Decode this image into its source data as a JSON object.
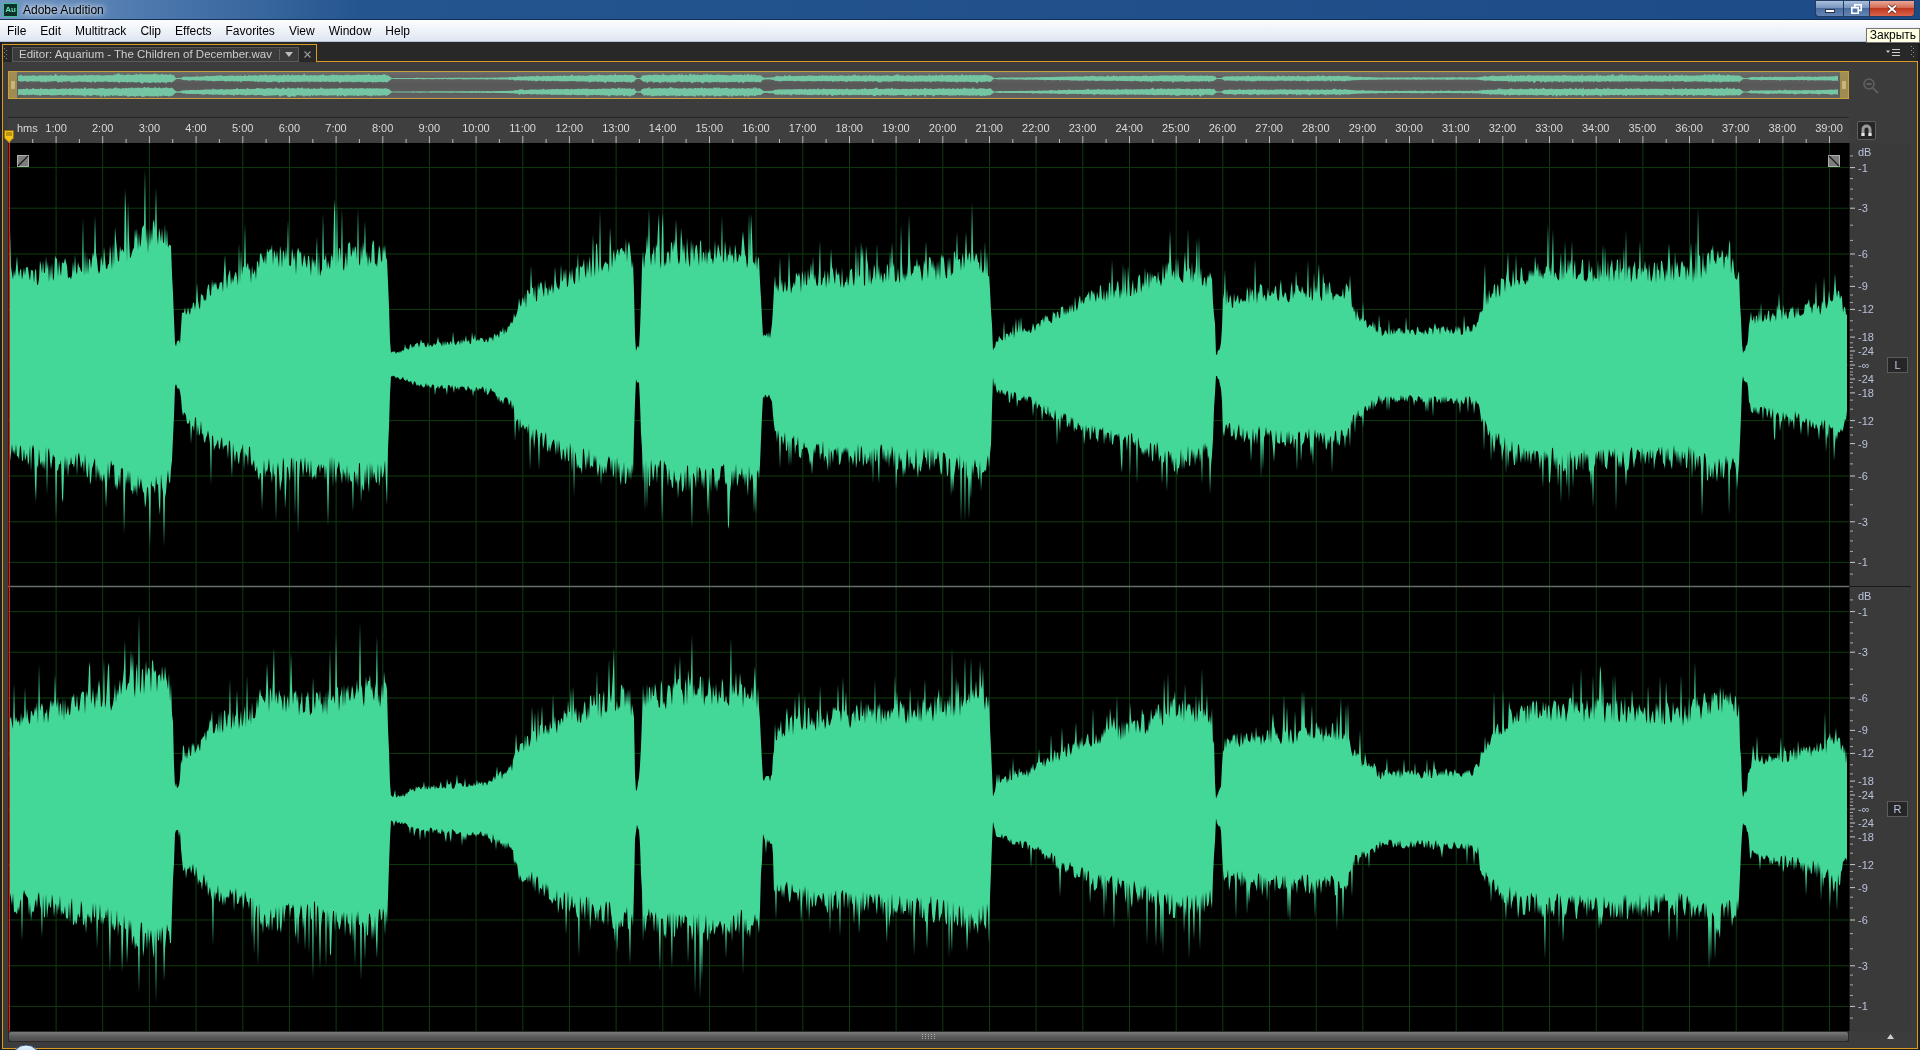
{
  "window": {
    "logo": "Au",
    "title": "Adobe Audition"
  },
  "tooltip": "Закрыть",
  "menu": [
    {
      "label": "File"
    },
    {
      "label": "Edit"
    },
    {
      "label": "Multitrack"
    },
    {
      "label": "Clip"
    },
    {
      "label": "Effects"
    },
    {
      "label": "Favorites"
    },
    {
      "label": "View"
    },
    {
      "label": "Window"
    },
    {
      "label": "Help"
    }
  ],
  "tabs": [
    {
      "label": "Editor: Aquarium - The Children of December.wav",
      "selected": true
    }
  ],
  "overview": {
    "zoom_out": {
      "disabled": true
    }
  },
  "ruler": {
    "labels": [
      "hms",
      "1:00",
      "2:00",
      "3:00",
      "4:00",
      "5:00",
      "6:00",
      "7:00",
      "8:00",
      "9:00",
      "10:00",
      "11:00",
      "12:00",
      "13:00",
      "14:00",
      "15:00",
      "16:00",
      "17:00",
      "18:00",
      "19:00",
      "20:00",
      "21:00",
      "22:00",
      "23:00",
      "24:00",
      "25:00",
      "26:00",
      "27:00",
      "28:00",
      "29:00",
      "30:00",
      "31:00",
      "32:00",
      "33:00",
      "34:00",
      "35:00",
      "36:00",
      "37:00",
      "38:00",
      "39:00"
    ]
  },
  "channels": [
    {
      "label": "L",
      "scale": [
        "dB",
        "-1",
        "-3",
        "-6",
        "-9",
        "-12",
        "-18",
        "-24",
        "-∞",
        "-24",
        "-18",
        "-12",
        "-9",
        "-6",
        "-3",
        "-1"
      ]
    },
    {
      "label": "R",
      "scale": [
        "dB",
        "-1",
        "-3",
        "-6",
        "-9",
        "-12",
        "-18",
        "-24",
        "-∞",
        "-24",
        "-18",
        "-12",
        "-9",
        "-6",
        "-3",
        "-1"
      ]
    }
  ]
}
